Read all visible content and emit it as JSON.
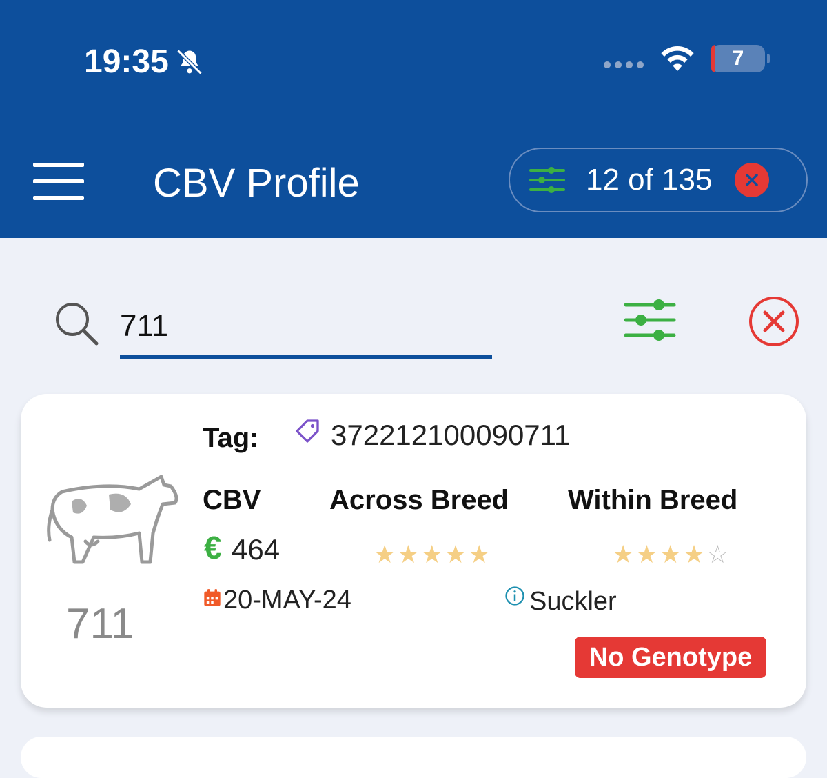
{
  "status_bar": {
    "time": "19:35",
    "battery": "7"
  },
  "header": {
    "title": "CBV Profile",
    "count": "12 of 135"
  },
  "search": {
    "value": "711",
    "placeholder": ""
  },
  "card": {
    "animal_number": "711",
    "tag_label": "Tag:",
    "tag_value": "372212100090711",
    "cbv_label": "CBV",
    "across_label": "Across Breed",
    "within_label": "Within Breed",
    "currency": "€",
    "cbv_value": "464",
    "across_stars": 5,
    "within_stars": 4,
    "max_stars": 5,
    "date": "20-MAY-24",
    "type": "Suckler",
    "badge": "No Genotype"
  },
  "colors": {
    "header": "#0d4f9c",
    "accent_green": "#3cb043",
    "danger_red": "#e53935",
    "star": "#f5cf85"
  },
  "icons": [
    "bell-slash-icon",
    "wifi-icon",
    "menu-icon",
    "filter-sliders-icon",
    "close-icon",
    "search-icon",
    "clear-circle-icon",
    "cow-icon",
    "tag-icon",
    "calendar-icon",
    "info-icon",
    "star-icon"
  ]
}
